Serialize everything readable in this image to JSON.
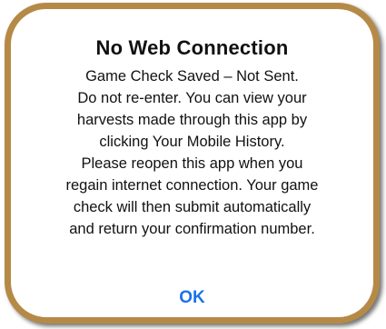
{
  "alert": {
    "title": "No Web Connection",
    "message_lines": [
      "Game Check Saved – Not Sent.",
      "Do not re-enter. You can view your",
      "harvests made through this app by",
      "clicking Your Mobile History.",
      "Please reopen this app when you",
      "regain internet connection. Your game",
      "check will then submit automatically",
      "and return your confirmation number."
    ],
    "ok_label": "OK"
  },
  "colors": {
    "frame_border": "#b58a47",
    "button_text": "#1a73e8"
  }
}
